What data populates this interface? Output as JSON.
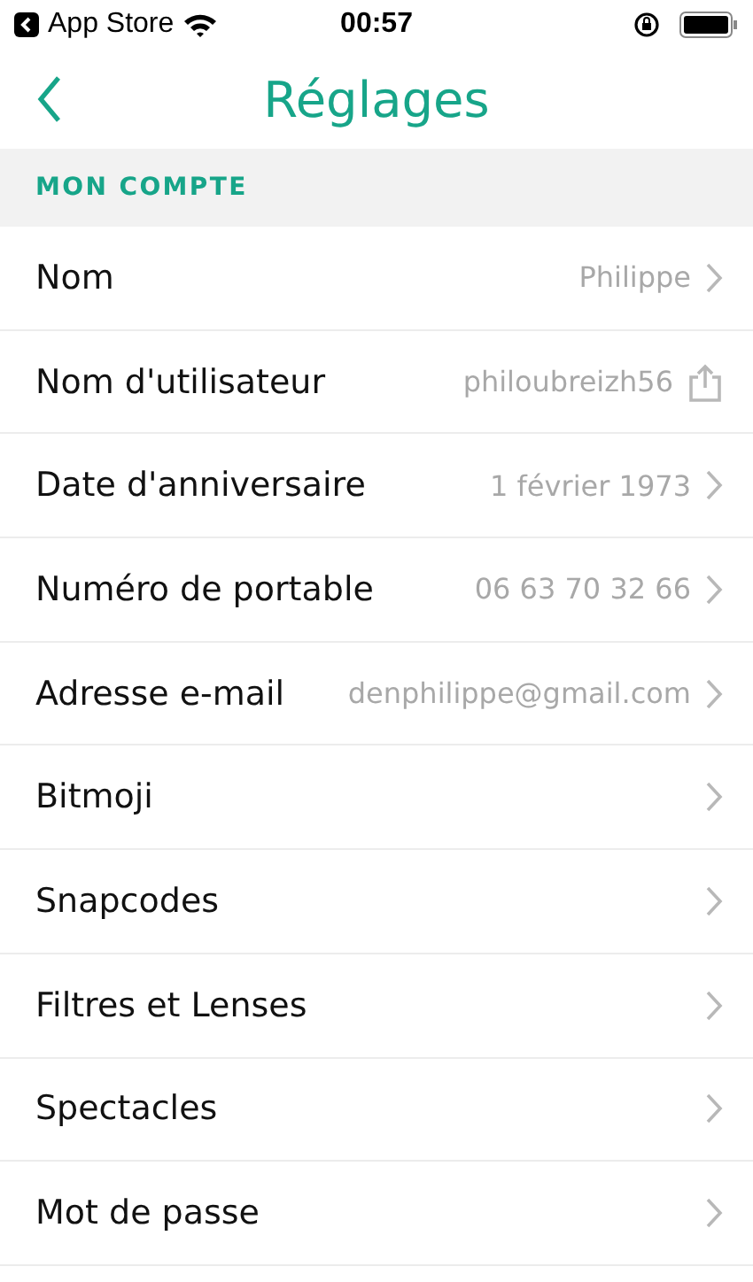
{
  "status_bar": {
    "back_app": "App Store",
    "time": "00:57"
  },
  "nav": {
    "title": "Réglages"
  },
  "section": {
    "title": "MON COMPTE"
  },
  "rows": [
    {
      "label": "Nom",
      "value": "Philippe",
      "kind": "chevron"
    },
    {
      "label": "Nom d'utilisateur",
      "value": "philoubreizh56",
      "kind": "share"
    },
    {
      "label": "Date d'anniversaire",
      "value": "1 février 1973",
      "kind": "chevron"
    },
    {
      "label": "Numéro de portable",
      "value": "06 63 70 32 66",
      "kind": "chevron"
    },
    {
      "label": "Adresse e-mail",
      "value": "denphilippe@gmail.com",
      "kind": "chevron"
    },
    {
      "label": "Bitmoji",
      "kind": "chevron"
    },
    {
      "label": "Snapcodes",
      "kind": "chevron"
    },
    {
      "label": "Filtres et Lenses",
      "kind": "chevron"
    },
    {
      "label": "Spectacles",
      "kind": "chevron"
    },
    {
      "label": "Mot de passe",
      "kind": "chevron"
    }
  ]
}
